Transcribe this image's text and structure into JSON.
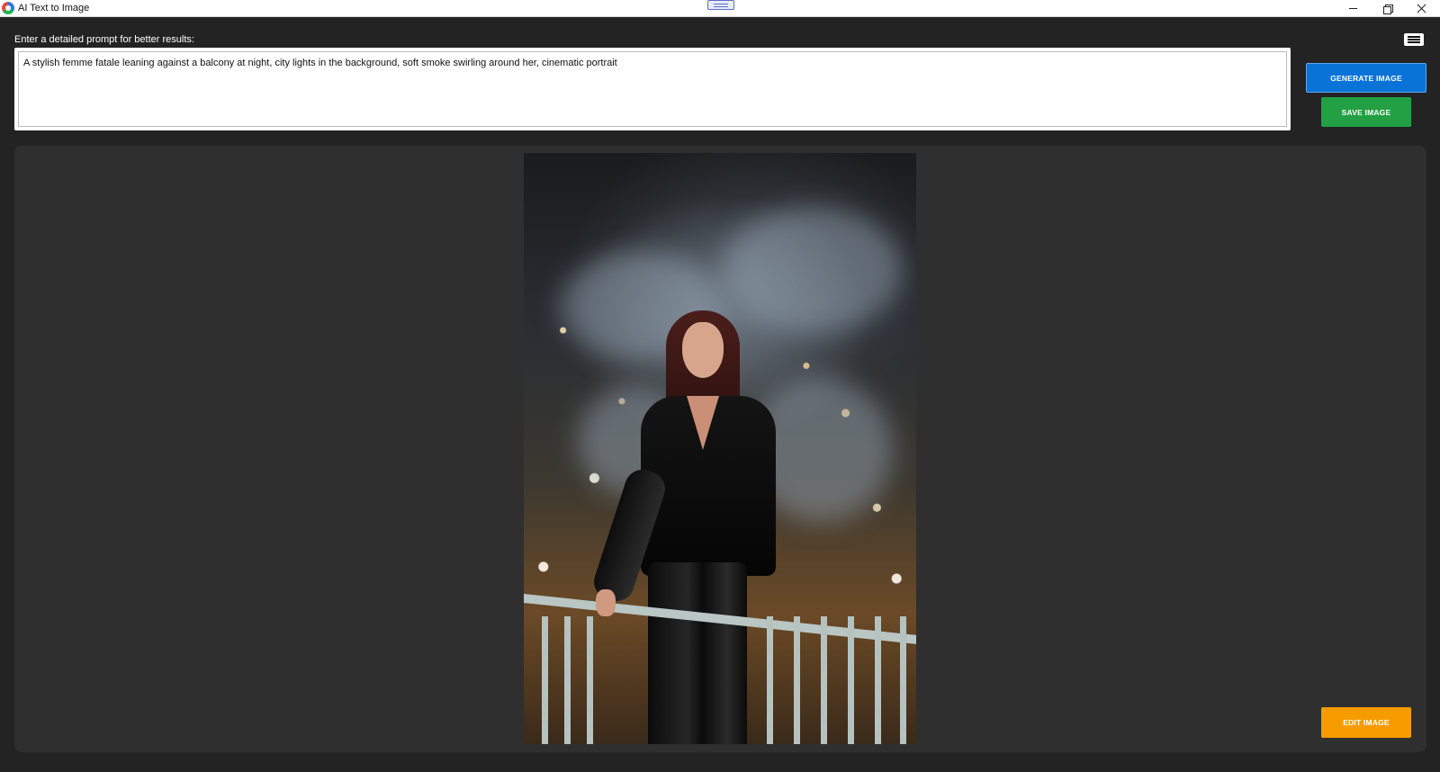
{
  "window": {
    "title": "AI Text to Image",
    "icon": "app-logo-icon",
    "controls": [
      "minimize-icon",
      "maximize-icon",
      "close-icon"
    ]
  },
  "prompt": {
    "label": "Enter a detailed prompt for better results:",
    "value": "A stylish femme fatale leaning against a balcony at night, city lights in the background, soft smoke swirling around her, cinematic portrait"
  },
  "toolbar": {
    "menu_icon": "hamburger-menu-icon",
    "generate_label": "GENERATE IMAGE",
    "save_label": "SAVE IMAGE",
    "edit_label": "EDIT IMAGE"
  },
  "colors": {
    "background": "#232323",
    "panel": "#2f2f2f",
    "generate": "#0a73d8",
    "save": "#23a043",
    "edit": "#f69c00"
  }
}
